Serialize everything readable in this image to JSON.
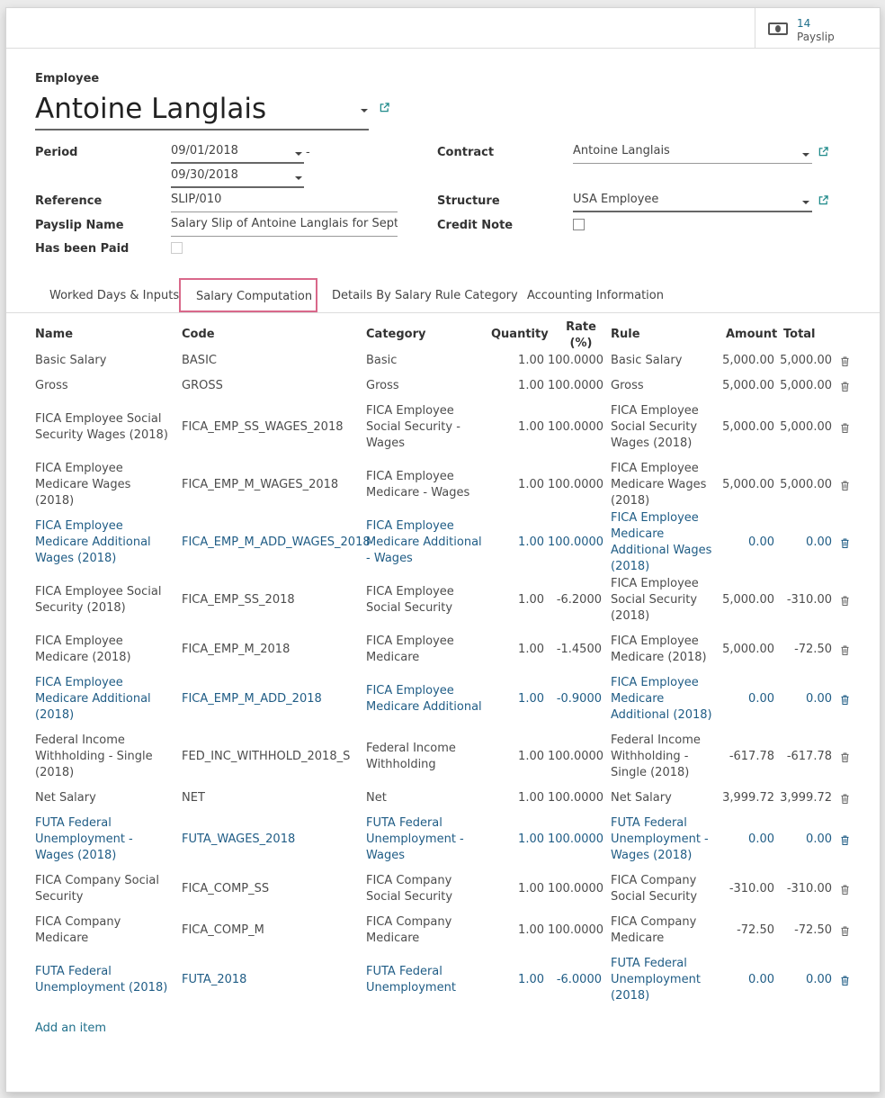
{
  "smart_button": {
    "count": "14",
    "label": "Payslip",
    "icon": "money-icon"
  },
  "employee": {
    "label": "Employee",
    "name": "Antoine Langlais"
  },
  "fields": {
    "period_label": "Period",
    "period_from": "09/01/2018",
    "period_sep": "-",
    "period_to": "09/30/2018",
    "reference_label": "Reference",
    "reference_value": "SLIP/010",
    "payslip_name_label": "Payslip Name",
    "payslip_name_value": "Salary Slip of Antoine Langlais for Septemb",
    "has_been_paid_label": "Has been Paid",
    "contract_label": "Contract",
    "contract_value": "Antoine Langlais",
    "structure_label": "Structure",
    "structure_value": "USA Employee",
    "credit_note_label": "Credit Note"
  },
  "tabs": [
    "Worked Days & Inputs",
    "Salary Computation",
    "Details By Salary Rule Category",
    "Accounting Information"
  ],
  "active_tab": "Salary Computation",
  "table": {
    "headers": {
      "name": "Name",
      "code": "Code",
      "category": "Category",
      "quantity": "Quantity",
      "rate": "Rate (%)",
      "rule": "Rule",
      "amount": "Amount",
      "total": "Total"
    },
    "rows": [
      {
        "name": "Basic Salary",
        "code": "BASIC",
        "category": "Basic",
        "quantity": "1.00",
        "rate": "100.0000",
        "rule": "Basic Salary",
        "amount": "5,000.00",
        "total": "5,000.00",
        "highlight": false
      },
      {
        "name": "Gross",
        "code": "GROSS",
        "category": "Gross",
        "quantity": "1.00",
        "rate": "100.0000",
        "rule": "Gross",
        "amount": "5,000.00",
        "total": "5,000.00",
        "highlight": false
      },
      {
        "name": "FICA Employee Social Security Wages (2018)",
        "code": "FICA_EMP_SS_WAGES_2018",
        "category": "FICA Employee Social Security - Wages",
        "quantity": "1.00",
        "rate": "100.0000",
        "rule": "FICA Employee Social Security Wages (2018)",
        "amount": "5,000.00",
        "total": "5,000.00",
        "highlight": false
      },
      {
        "name": "FICA Employee Medicare Wages (2018)",
        "code": "FICA_EMP_M_WAGES_2018",
        "category": "FICA Employee Medicare - Wages",
        "quantity": "1.00",
        "rate": "100.0000",
        "rule": "FICA Employee Medicare Wages (2018)",
        "amount": "5,000.00",
        "total": "5,000.00",
        "highlight": false
      },
      {
        "name": "FICA Employee Medicare Additional Wages (2018)",
        "code": "FICA_EMP_M_ADD_WAGES_2018",
        "category": "FICA Employee Medicare Additional - Wages",
        "quantity": "1.00",
        "rate": "100.0000",
        "rule": "FICA Employee Medicare Additional Wages (2018)",
        "amount": "0.00",
        "total": "0.00",
        "highlight": true
      },
      {
        "name": "FICA Employee Social Security (2018)",
        "code": "FICA_EMP_SS_2018",
        "category": "FICA Employee Social Security",
        "quantity": "1.00",
        "rate": "-6.2000",
        "rule": "FICA Employee Social Security (2018)",
        "amount": "5,000.00",
        "total": "-310.00",
        "highlight": false
      },
      {
        "name": "FICA Employee Medicare (2018)",
        "code": "FICA_EMP_M_2018",
        "category": "FICA Employee Medicare",
        "quantity": "1.00",
        "rate": "-1.4500",
        "rule": "FICA Employee Medicare (2018)",
        "amount": "5,000.00",
        "total": "-72.50",
        "highlight": false
      },
      {
        "name": "FICA Employee Medicare Additional (2018)",
        "code": "FICA_EMP_M_ADD_2018",
        "category": "FICA Employee Medicare Additional",
        "quantity": "1.00",
        "rate": "-0.9000",
        "rule": "FICA Employee Medicare Additional (2018)",
        "amount": "0.00",
        "total": "0.00",
        "highlight": true
      },
      {
        "name": "Federal Income Withholding - Single (2018)",
        "code": "FED_INC_WITHHOLD_2018_S",
        "category": "Federal Income Withholding",
        "quantity": "1.00",
        "rate": "100.0000",
        "rule": "Federal Income Withholding - Single (2018)",
        "amount": "-617.78",
        "total": "-617.78",
        "highlight": false
      },
      {
        "name": "Net Salary",
        "code": "NET",
        "category": "Net",
        "quantity": "1.00",
        "rate": "100.0000",
        "rule": "Net Salary",
        "amount": "3,999.72",
        "total": "3,999.72",
        "highlight": false
      },
      {
        "name": "FUTA Federal Unemployment - Wages (2018)",
        "code": "FUTA_WAGES_2018",
        "category": "FUTA Federal Unemployment - Wages",
        "quantity": "1.00",
        "rate": "100.0000",
        "rule": "FUTA Federal Unemployment - Wages (2018)",
        "amount": "0.00",
        "total": "0.00",
        "highlight": true
      },
      {
        "name": "FICA Company Social Security",
        "code": "FICA_COMP_SS",
        "category": "FICA Company Social Security",
        "quantity": "1.00",
        "rate": "100.0000",
        "rule": "FICA Company Social Security",
        "amount": "-310.00",
        "total": "-310.00",
        "highlight": false
      },
      {
        "name": "FICA Company Medicare",
        "code": "FICA_COMP_M",
        "category": "FICA Company Medicare",
        "quantity": "1.00",
        "rate": "100.0000",
        "rule": "FICA Company Medicare",
        "amount": "-72.50",
        "total": "-72.50",
        "highlight": false
      },
      {
        "name": "FUTA Federal Unemployment (2018)",
        "code": "FUTA_2018",
        "category": "FUTA Federal Unemployment",
        "quantity": "1.00",
        "rate": "-6.0000",
        "rule": "FUTA Federal Unemployment (2018)",
        "amount": "0.00",
        "total": "0.00",
        "highlight": true
      }
    ],
    "add_item": "Add an item",
    "delete_icon": "trash-icon"
  },
  "colors": {
    "link_blue": "#1f5c85",
    "active_tab_border": "#d9688a"
  }
}
